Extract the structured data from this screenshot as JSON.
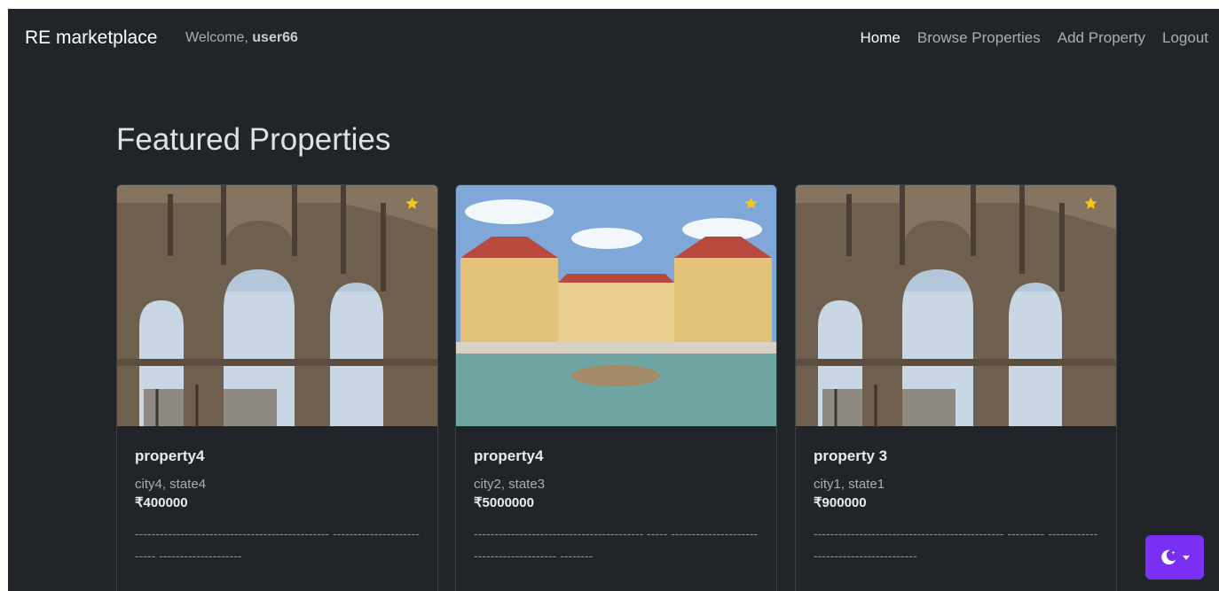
{
  "navbar": {
    "brand": "RE marketplace",
    "welcome_prefix": "Welcome, ",
    "username": "user66",
    "links": [
      {
        "label": "Home",
        "active": true
      },
      {
        "label": "Browse Properties",
        "active": false
      },
      {
        "label": "Add Property",
        "active": false
      },
      {
        "label": "Logout",
        "active": false
      }
    ]
  },
  "featured": {
    "title": "Featured Properties",
    "cards": [
      {
        "image": "colosseum-arches-photo",
        "favorite_icon": "star-icon",
        "title": "property4",
        "location": "city4, state4",
        "price": "₹400000",
        "description": "----------------------------------------------- -------------------------- --------------------"
      },
      {
        "image": "palace-fountain-photo",
        "favorite_icon": "star-icon",
        "title": "property4",
        "location": "city2, state3",
        "price": "₹5000000",
        "description": "----------------------------------------- ----- ----------------------------------------- --------"
      },
      {
        "image": "colosseum-arches-photo",
        "favorite_icon": "star-icon",
        "title": "property 3",
        "location": "city1, state1",
        "price": "₹900000",
        "description": "---------------------------------------------- --------- -------------------------------------"
      }
    ]
  },
  "theme_toggle": {
    "icon": "moon-stars-icon",
    "caret": "caret-down-icon",
    "color": "#7a30f2"
  },
  "colors": {
    "background": "#212529",
    "accent_star": "#f5c518"
  }
}
